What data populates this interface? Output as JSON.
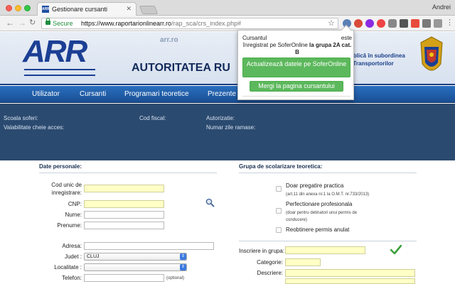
{
  "browser": {
    "tab_title": "Gestionare cursanti",
    "tab_favicon_text": "ARR",
    "user_name": "Andrei",
    "secure_label": "Secure",
    "url_host": "https://www.raportarionlinearr.ro",
    "url_path": "/rap_sca/crs_index.php#"
  },
  "header": {
    "logo_text": "ARR",
    "watermark": "arr.ro",
    "title": "AUTORITATEA RU",
    "right_line1": "ublică în subordinea",
    "right_line2": "i Transportorilor"
  },
  "nav": {
    "items": [
      "Utilizator",
      "Cursanti",
      "Programari teoretice",
      "Prezente c"
    ]
  },
  "info": {
    "scoala": "Scoala soferi:",
    "valabilitate": "Valabilitate cheie acces:",
    "cod_fiscal": "Cod fiscal:",
    "autorizatie": "Autorizatie:",
    "numar_zile": "Numar zile ramase:"
  },
  "popup": {
    "line1_a": "Cursantul",
    "line1_b": "este",
    "line2_a": "înregistrat pe SoferOnline",
    "line2_b": " la grupa 2A cat.",
    "line3": "B",
    "update_button": "Actualizează datele pe SoferOnline",
    "open_button": "Mergi la pagina cursantului"
  },
  "form": {
    "personal_title": "Date personale:",
    "group_title": "Grupa de scolarizare teoretica:",
    "cod_unic_label1": "Cod unic de",
    "cod_unic_label2": "inregistrare:",
    "cnp_label": "CNP:",
    "nume_label": "Nume:",
    "prenume_label": "Prenume:",
    "adresa_label": "Adresa:",
    "judet_label": "Judet :",
    "judet_value": "CLUJ",
    "localitate_label": "Localitate :",
    "telefon_label": "Telefon:",
    "telefon_optional": "(optional)",
    "opt1_line1": "Doar pregatire practica",
    "opt1_line2": "(art.11 din anexa nr.1 la O.M.T. nr.733/2013)",
    "opt2_line1": "Perfectionare profesionala",
    "opt2_line2": "(doar pentru detinatori unui permis de",
    "opt2_line3": "conducere)",
    "opt3": "Reobtinere permis anulat",
    "inscriere_label": "Inscriere in grupa:",
    "categorie_label": "Categorie:",
    "descriere_label": "Descriere:"
  },
  "colors": {
    "nav_blue": "#1a4f93",
    "info_dark": "#2b4a6f",
    "popup_green": "#5cb85c",
    "input_yellow": "#ffffc6"
  }
}
